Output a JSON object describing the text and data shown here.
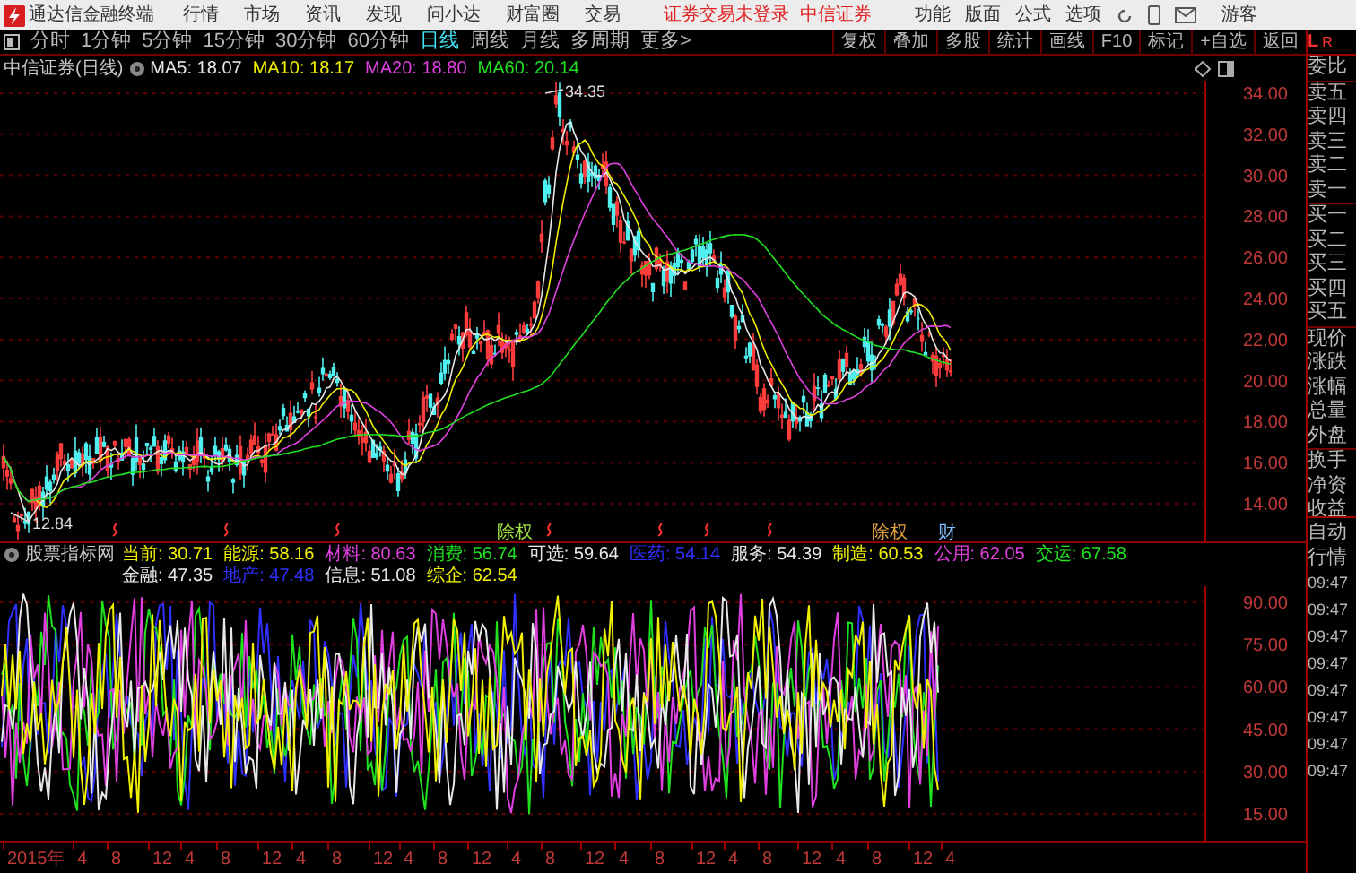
{
  "app": {
    "title": "通达信金融终端",
    "menu": [
      "行情",
      "市场",
      "资讯",
      "发现",
      "问小达",
      "财富圈",
      "交易"
    ],
    "login_status": "证券交易未登录",
    "broker": "中信证券",
    "tools": [
      "功能",
      "版面",
      "公式",
      "选项"
    ],
    "user": "游客"
  },
  "period_tabs": [
    {
      "label": "分时",
      "selected": false
    },
    {
      "label": "1分钟",
      "selected": false
    },
    {
      "label": "5分钟",
      "selected": false
    },
    {
      "label": "15分钟",
      "selected": false
    },
    {
      "label": "30分钟",
      "selected": false
    },
    {
      "label": "60分钟",
      "selected": false
    },
    {
      "label": "日线",
      "selected": true
    },
    {
      "label": "周线",
      "selected": false
    },
    {
      "label": "月线",
      "selected": false
    },
    {
      "label": "多周期",
      "selected": false
    },
    {
      "label": "更多>",
      "selected": false
    }
  ],
  "chart_tools": [
    "复权",
    "叠加",
    "多股",
    "统计",
    "画线",
    "F10",
    "标记",
    "+自选",
    "返回"
  ],
  "panel_toggle": [
    "L",
    "R"
  ],
  "price_chart": {
    "title": "中信证券(日线)",
    "ma": [
      {
        "label": "MA5: 18.07",
        "color": "#e8e8e8"
      },
      {
        "label": "MA10: 18.17",
        "color": "#f0f000"
      },
      {
        "label": "MA20: 18.80",
        "color": "#e040e0"
      },
      {
        "label": "MA60: 20.14",
        "color": "#20e020"
      }
    ],
    "high_label": "34.35",
    "low_label": "12.84",
    "yticks": [
      "34.00",
      "32.00",
      "30.00",
      "28.00",
      "26.00",
      "24.00",
      "22.00",
      "20.00",
      "18.00",
      "16.00",
      "14.00"
    ],
    "events": [
      {
        "kind": "flag"
      },
      {
        "kind": "flag"
      },
      {
        "kind": "flag"
      },
      {
        "kind": "tag",
        "label": "除权",
        "color": "#a0e040"
      },
      {
        "kind": "flag"
      },
      {
        "kind": "flag"
      },
      {
        "kind": "flag"
      },
      {
        "kind": "flag"
      },
      {
        "kind": "tag",
        "label": "除权",
        "color": "#e0a040"
      },
      {
        "kind": "tag",
        "label": "财",
        "color": "#80c0ff"
      }
    ]
  },
  "quote_panel": {
    "groups": [
      [
        "委比"
      ],
      [
        "卖五",
        "卖四",
        "卖三",
        "卖二",
        "卖一"
      ],
      [
        "买一",
        "买二",
        "买三",
        "买四",
        "买五"
      ],
      [
        "现价",
        "涨跌",
        "涨幅",
        "总量",
        "外盘"
      ],
      [
        "换手",
        "净资",
        "收益"
      ]
    ],
    "mode": [
      "自动",
      "行情"
    ],
    "times": [
      "09:47",
      "09:47",
      "09:47",
      "09:47",
      "09:47",
      "09:47",
      "09:47",
      "09:47"
    ]
  },
  "indicator": {
    "title": "股票指标网",
    "items": [
      {
        "label": "当前: 30.71",
        "color": "#f0f000"
      },
      {
        "label": "能源: 58.16",
        "color": "#f0f000"
      },
      {
        "label": "材料: 80.63",
        "color": "#e040e0"
      },
      {
        "label": "消费: 56.74",
        "color": "#20e020"
      },
      {
        "label": "可选: 59.64",
        "color": "#e8e8e8"
      },
      {
        "label": "医药: 54.14",
        "color": "#3030ff"
      },
      {
        "label": "服务: 54.39",
        "color": "#e8e8e8"
      },
      {
        "label": "制造: 60.53",
        "color": "#f0f000"
      },
      {
        "label": "公用: 62.05",
        "color": "#e040e0"
      },
      {
        "label": "交运: 67.58",
        "color": "#20e020"
      },
      {
        "label": "金融: 47.35",
        "color": "#e8e8e8"
      },
      {
        "label": "地产: 47.48",
        "color": "#3030ff"
      },
      {
        "label": "信息: 51.08",
        "color": "#e8e8e8"
      },
      {
        "label": "综企: 62.54",
        "color": "#f0f000"
      }
    ],
    "yticks": [
      "90.00",
      "75.00",
      "60.00",
      "45.00",
      "30.00",
      "15.00"
    ]
  },
  "date_axis": [
    "2015年",
    "4",
    "8",
    "12",
    "4",
    "8",
    "12",
    "4",
    "8",
    "12",
    "4",
    "8",
    "12",
    "4",
    "8",
    "12",
    "4",
    "8",
    "12",
    "4",
    "8",
    "12",
    "4",
    "8",
    "12",
    "4"
  ]
}
